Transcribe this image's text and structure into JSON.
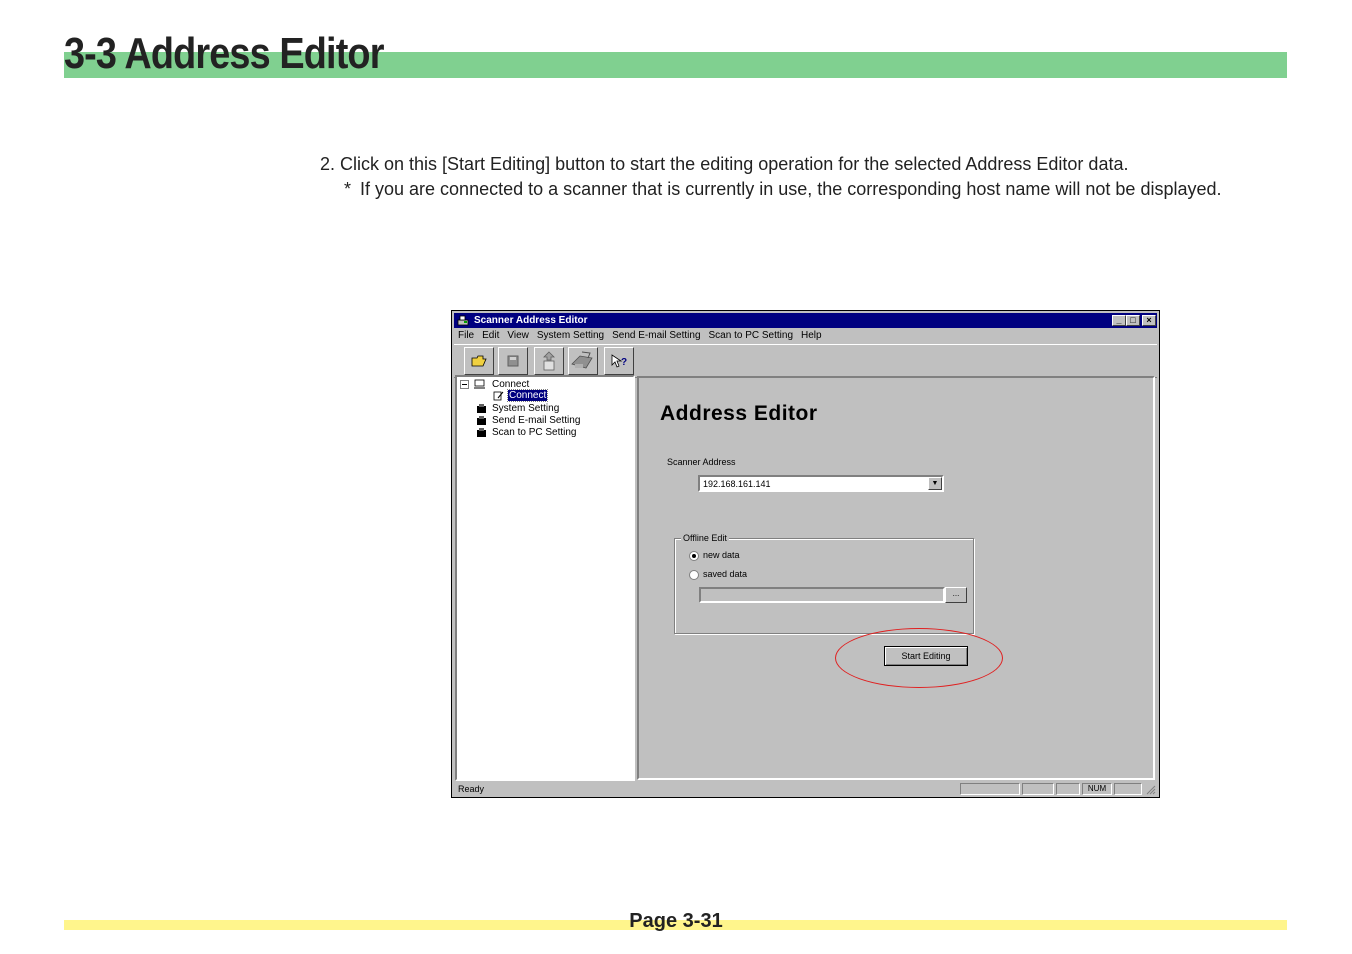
{
  "header": {
    "title": "3-3  Address Editor"
  },
  "instructions": {
    "step": "2. Click on this [Start Editing] button to start the editing operation for the selected Address Editor data.",
    "note_mark": "*",
    "note": "If you are connected to a scanner that is currently in use, the corresponding host name will not be displayed."
  },
  "window": {
    "title": "Scanner Address Editor",
    "menu": [
      "File",
      "Edit",
      "View",
      "System Setting",
      "Send E-mail Setting",
      "Scan to PC Setting",
      "Help"
    ],
    "tree": {
      "root": "Connect",
      "child": "Connect",
      "items": [
        "System Setting",
        "Send E-mail Setting",
        "Scan to PC Setting"
      ]
    },
    "main": {
      "title": "Address Editor",
      "scanner_address_label": "Scanner Address",
      "scanner_address_value": "192.168.161.141",
      "offline_edit_label": "Offline Edit",
      "radio_new": "new data",
      "radio_saved": "saved data",
      "browse_label": "...",
      "start_button": "Start Editing"
    },
    "status": {
      "text": "Ready",
      "num": "NUM"
    }
  },
  "footer": {
    "page": "Page 3-31"
  },
  "colors": {
    "header_bar": "#80d090",
    "footer_bar": "#fff58c",
    "highlight": "#e02020",
    "titlebar": "#000080"
  }
}
